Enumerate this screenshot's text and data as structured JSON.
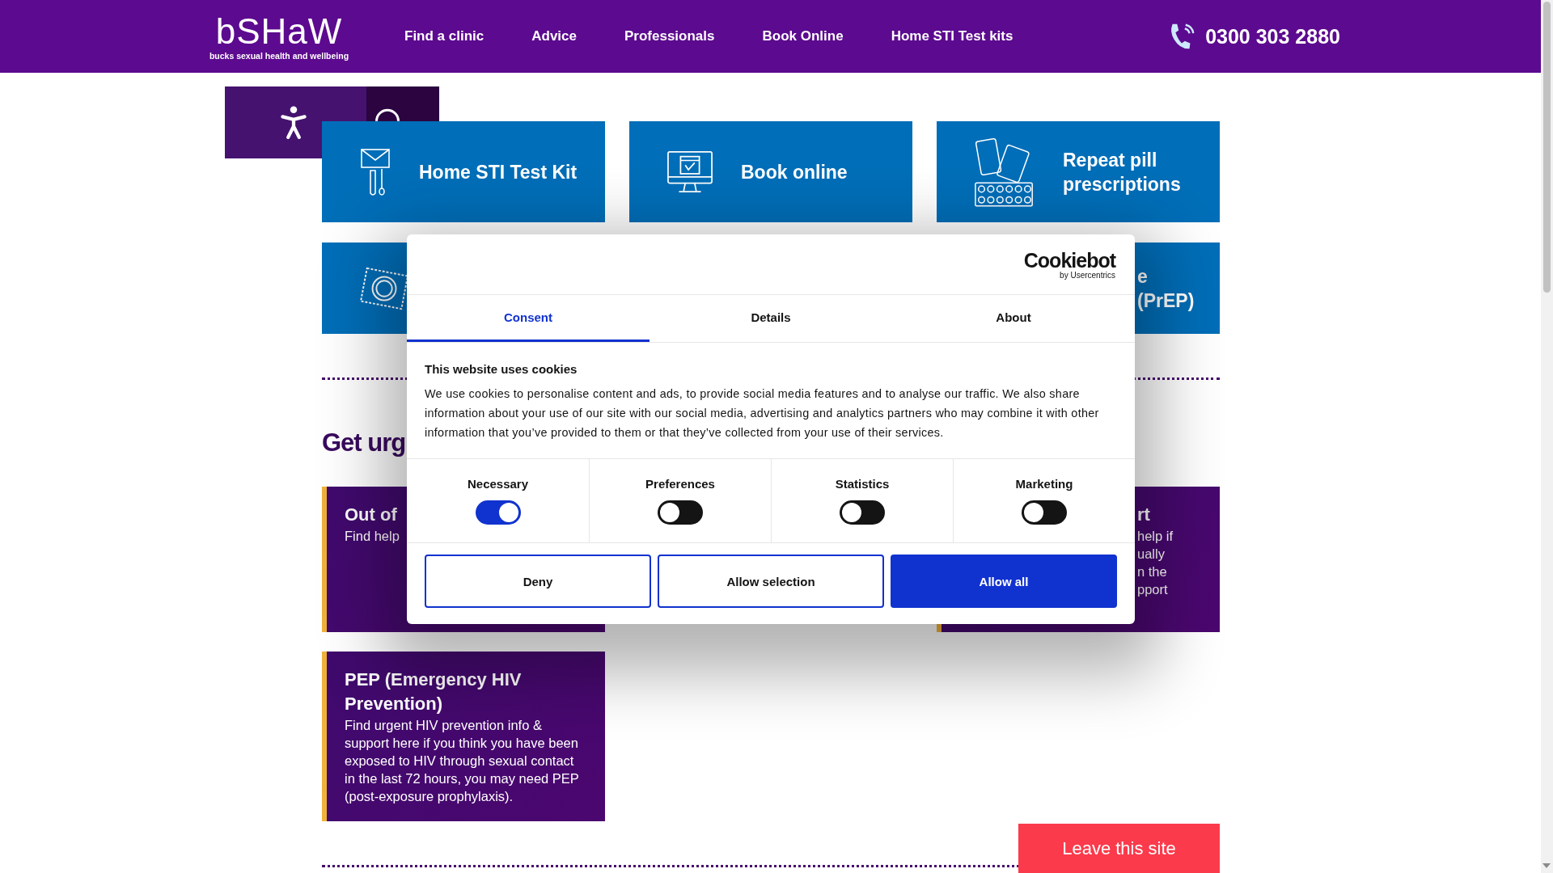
{
  "header": {
    "logo": {
      "name": "bSHaW",
      "tagline": "bucks sexual health and wellbeing"
    },
    "nav": [
      {
        "label": "Find a clinic"
      },
      {
        "label": "Advice"
      },
      {
        "label": "Professionals"
      },
      {
        "label": "Book Online"
      },
      {
        "label": "Home STI Test kits"
      }
    ],
    "phone": "0300 303 2880"
  },
  "quick_links": [
    {
      "kind": "full",
      "lines": [
        "Home STI Test Kit"
      ]
    },
    {
      "kind": "full",
      "lines": [
        "Book online"
      ]
    },
    {
      "kind": "full",
      "lines": [
        "Repeat pill",
        "prescriptions"
      ]
    },
    {
      "kind": "full"
    },
    {
      "kind": "clipped",
      "lines": [
        "e",
        "(PrEP)"
      ]
    }
  ],
  "urgent": {
    "heading": "Get urg",
    "cards": [
      {
        "kind": "full",
        "title": "Out of",
        "body": "Find help"
      },
      {
        "kind": "clipped",
        "title": "rt",
        "lines": [
          "help if",
          "ually",
          "n the",
          "pport"
        ]
      },
      {
        "kind": "full",
        "title": "PEP (Emergency HIV Prevention)",
        "body": "Find urgent HIV prevention info & support here if you think you have been exposed to HIV through sexual contact in the last 72 hours, you may need PEP (post-exposure prophylaxis)."
      }
    ]
  },
  "leave_button": "Leave this site",
  "cookie_dialog": {
    "brand": {
      "name": "Cookiebot",
      "by": "by Usercentrics"
    },
    "tabs": [
      {
        "label": "Consent",
        "selected": true
      },
      {
        "label": "Details",
        "selected": false
      },
      {
        "label": "About",
        "selected": false
      }
    ],
    "title": "This website uses cookies",
    "text": "We use cookies to personalise content and ads, to provide social media features and to analyse our traffic. We also share information about your use of our site with our social media, advertising and analytics partners who may combine it with other information that you’ve provided to them or that they’ve collected from your use of their services.",
    "categories": [
      {
        "label": "Necessary",
        "checked": true
      },
      {
        "label": "Preferences",
        "checked": false
      },
      {
        "label": "Statistics",
        "checked": false
      },
      {
        "label": "Marketing",
        "checked": false
      }
    ],
    "buttons": [
      {
        "label": "Deny",
        "kind": "outline"
      },
      {
        "label": "Allow selection",
        "kind": "outline"
      },
      {
        "label": "Allow all",
        "kind": "primary"
      }
    ]
  }
}
